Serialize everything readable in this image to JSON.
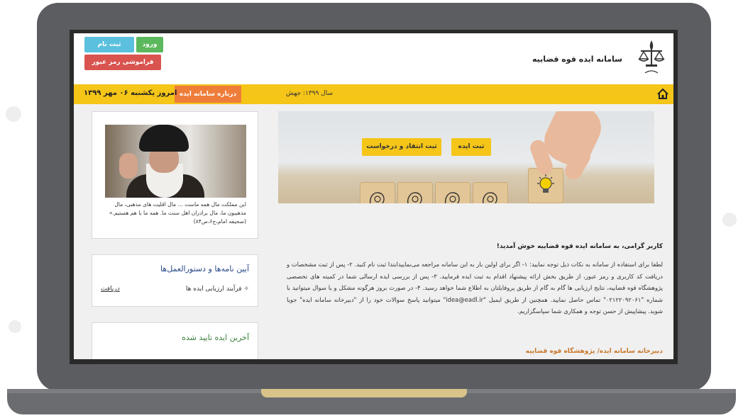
{
  "site": {
    "title": "سامانه ایده قوه قضاییه",
    "emblem_caption": "قوه قضاییه"
  },
  "auth": {
    "login_label": "ورود",
    "register_label": "ثبت نام",
    "forgot_label": "فراموشی رمز عبور"
  },
  "nav": {
    "year_text": "سال ۱۳۹۹: جهش",
    "about_label": "درباره سامانه ایده",
    "today_text": "امروز یکشنبه ۰۶ مهر ۱۳۹۹"
  },
  "hero": {
    "submit_idea_label": "ثبت ایده",
    "submit_criticism_label": "ثبت انتقاد و درخواست"
  },
  "main": {
    "welcome": "کاربر گرامی، به سامانه ایده قوه قضاییه خوش آمدید!",
    "instructions": "لطفا برای استفاده از سامانه به نکات ذیل توجه نمایید: ۱- اگر برای اولین بار به این سامانه مراجعه می‌نماییدابتدا ثبت نام کنید. ۲- پس از ثبت مشخصات و دریافت کد کاربری و رمز عبور، از طریق بخش ارائه پیشنهاد اقدام به ثبت ایده فرمایید. ۳- پس از بررسی ایده ارسالی شما در کمیته های تخصصی پژوهشگاه قوه قضاییه، نتایج ارزیابی ها گام به گام از طریق پروفایلتان به اطلاع شما خواهد رسید. ۴- در صورت بروز هرگونه مشکل و یا سوال میتوانید با شماره \"۰۲۱۲۲۰۹۲۰۶۱\" تماس حاصل نمایید. همچنین از طریق ایمیل \"idea@eadl.ir\" میتوانید پاسخ سوالات خود را از \"دبیرخانه سامانه ایده\" جویا شوید. پیشاپیش از حسن توجه و همکاری شما سپاسگزاریم.",
    "signature": "دبیرخانه سامانه ایده/ پژوهشگاه قوه قضاییه"
  },
  "sidebar": {
    "quote": "این مملکت مال همه ماست ... مال اقلیت های مذهبی، مال مذهبیون ما، مال برادران اهل سنت ما. همه ما با هم هستیم.» (صحیفه امام،ج۶،ص۸۴)",
    "regulations_title": "آیین نامه‌ها و دستورالعمل‌ها",
    "regulations_item": "فرآیند ارزیابی ایده ها",
    "regulations_link": "دریافت",
    "approved_title": "آخرین ایده تایید شده"
  },
  "colors": {
    "nav_bar": "#f5c518",
    "about_button": "#ef7d3a",
    "login_button": "#5cb85c",
    "register_button": "#5bc0de",
    "forgot_button": "#d9534f",
    "laptop_frame": "#5c5d61"
  }
}
